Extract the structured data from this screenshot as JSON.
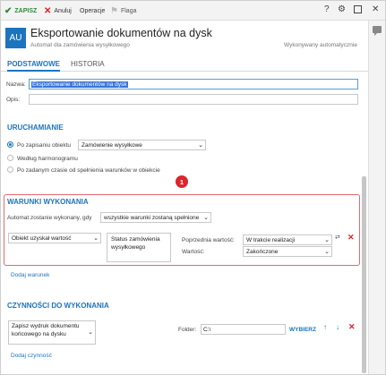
{
  "toolbar": {
    "save_label": "ZAPISZ",
    "cancel_label": "Anuluj",
    "operations_label": "Operacje",
    "flag_label": "Flaga",
    "help_label": "?"
  },
  "header": {
    "avatar_text": "AU",
    "title": "Eksportowanie dokumentów na dysk",
    "subtitle": "Automat dla zamówienia wysyłkowego",
    "status": "Wykonywany automatycznie"
  },
  "tabs": [
    {
      "label": "PODSTAWOWE",
      "active": true
    },
    {
      "label": "HISTORIA",
      "active": false
    }
  ],
  "form": {
    "name_label": "Nazwa:",
    "name_value": "Eksportowanie dokumentów na dysk",
    "desc_label": "Opis:",
    "desc_value": ""
  },
  "trigger": {
    "section_title": "URUCHAMIANIE",
    "option1_label": "Po zapisaniu obiektu",
    "option1_select": "Zamówienie wysyłkowe",
    "option2_label": "Według harmonogramu",
    "option3_label": "Po zadanym czasie od spełnienia warunków w obiekcie"
  },
  "badge": {
    "number": "1"
  },
  "conditions": {
    "section_title": "WARUNKI WYKONANIA",
    "run_when_label": "Automat zostanie wykonany, gdy",
    "run_when_select": "wszystkie warunki zostaną spełnione",
    "condition_type": "Obiekt uzyskał wartość",
    "field_name": "Status zamówienia wysyłkowego",
    "prev_value_label": "Poprzednia wartość:",
    "prev_value": "W trakcie realizacji",
    "value_label": "Wartość:",
    "value": "Zakończone",
    "add_label": "Dodaj warunek"
  },
  "actions": {
    "section_title": "CZYNNOŚCI DO WYKONANIA",
    "action_type": "Zapisz wydruk dokumentu końcowego na dysku",
    "folder_label": "Folder:",
    "folder_value": "C:\\",
    "choose_label": "WYBIERZ",
    "add_label": "Dodaj czynność"
  },
  "colors": {
    "accent": "#1c74bf",
    "save": "#2e8b3a",
    "delete": "#dd2222",
    "highlight_border": "#e06a6d"
  }
}
